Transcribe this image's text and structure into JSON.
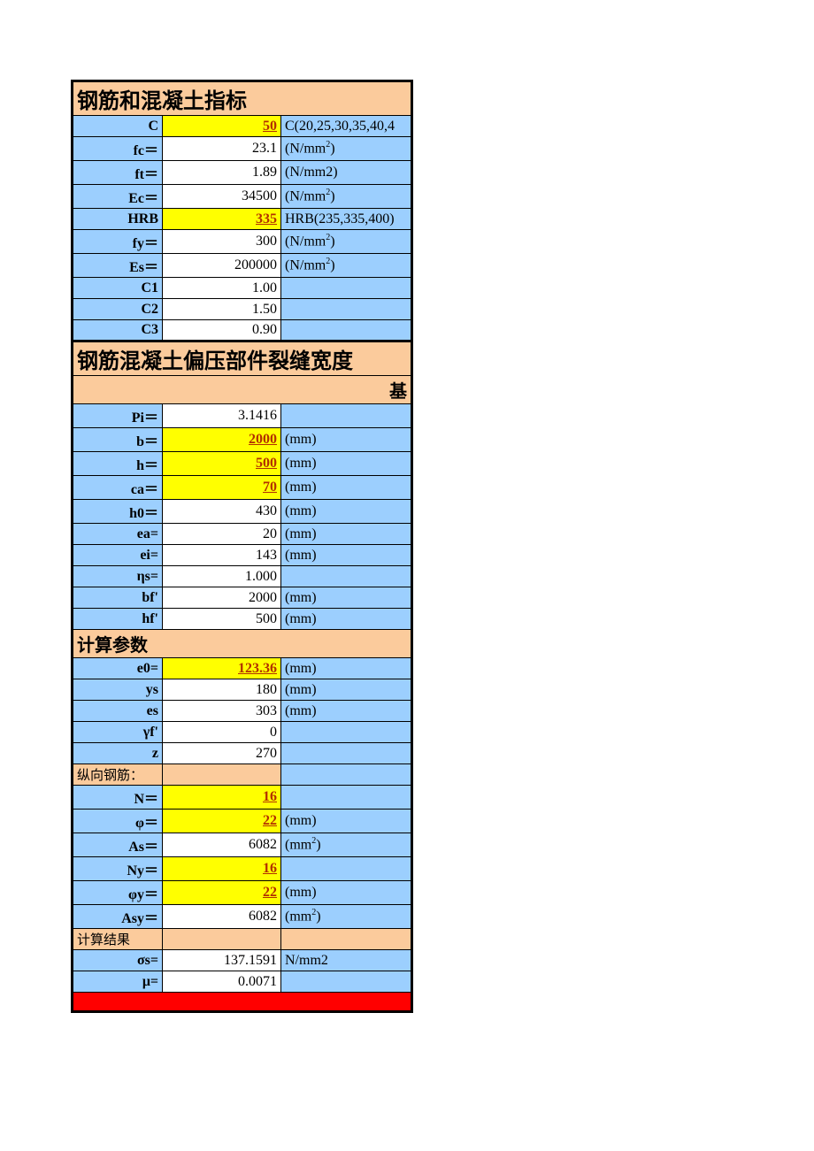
{
  "section1": {
    "title": "钢筋和混凝土指标",
    "rows": [
      {
        "label": "C",
        "value": "50",
        "unit": "C(20,25,30,35,40,4",
        "yellow": true,
        "bold": true
      },
      {
        "label": "fc＝",
        "value": "23.1",
        "unit": "(N/mm²)",
        "white": true
      },
      {
        "label": "ft＝",
        "value": "1.89",
        "unit": "(N/mm2)",
        "white": true
      },
      {
        "label": "Ec＝",
        "value": "34500",
        "unit": "(N/mm²)",
        "white": true
      },
      {
        "label": "HRB",
        "value": "335",
        "unit": "HRB(235,335,400)",
        "yellow": true,
        "bold": true
      },
      {
        "label": "fy＝",
        "value": "300",
        "unit": "(N/mm²)",
        "white": true
      },
      {
        "label": "Es＝",
        "value": "200000",
        "unit": "(N/mm²)",
        "white": true
      },
      {
        "label": "C1",
        "value": "1.00",
        "unit": "",
        "white": true
      },
      {
        "label": "C2",
        "value": "1.50",
        "unit": "",
        "white": true
      },
      {
        "label": "C3",
        "value": "0.90",
        "unit": "",
        "white": true
      }
    ]
  },
  "section2": {
    "title": "钢筋混凝土偏压部件裂缝宽度",
    "subtitle": "基",
    "rows": [
      {
        "label": "Pi＝",
        "value": "3.1416",
        "unit": "",
        "white": true
      },
      {
        "label": "b＝",
        "value": "2000",
        "unit": "(mm)",
        "yellow": true
      },
      {
        "label": "h＝",
        "value": "500",
        "unit": "(mm)",
        "yellow": true
      },
      {
        "label": "ca＝",
        "value": "70",
        "unit": "(mm)",
        "yellow": true
      },
      {
        "label": "h0＝",
        "value": "430",
        "unit": "(mm)",
        "white": true
      },
      {
        "label": "ea=",
        "value": "20",
        "unit": "(mm)",
        "white": true
      },
      {
        "label": "ei=",
        "value": "143",
        "unit": "(mm)",
        "white": true
      },
      {
        "label": "ηs=",
        "value": "1.000",
        "unit": "",
        "white": true
      },
      {
        "label": "bf'",
        "value": "2000",
        "unit": "(mm)",
        "white": true
      },
      {
        "label": "hf'",
        "value": "500",
        "unit": "(mm)",
        "white": true
      }
    ]
  },
  "section3": {
    "title": "计算参数",
    "rows": [
      {
        "label": "e0=",
        "value": "123.36",
        "unit": "(mm)",
        "yellow": true,
        "labelBlue": true
      },
      {
        "label": "ys",
        "value": "180",
        "unit": "(mm)",
        "white": true
      },
      {
        "label": "es",
        "value": "303",
        "unit": "(mm)",
        "white": true
      },
      {
        "label": "γf'",
        "value": "0",
        "unit": "",
        "white": true
      },
      {
        "label": "z",
        "value": "270",
        "unit": "",
        "white": true
      }
    ]
  },
  "section4": {
    "title": "纵向钢筋：",
    "rows": [
      {
        "label": "N＝",
        "value": "16",
        "unit": "",
        "yellow": true
      },
      {
        "label": "φ＝",
        "value": "22",
        "unit": "(mm)",
        "yellow": true
      },
      {
        "label": "As＝",
        "value": "6082",
        "unit": "(mm²)",
        "white": true
      },
      {
        "label": "Ny＝",
        "value": "16",
        "unit": "",
        "yellow": true
      },
      {
        "label": "φy＝",
        "value": "22",
        "unit": "(mm)",
        "yellow": true
      },
      {
        "label": "Asy＝",
        "value": "6082",
        "unit": "(mm²)",
        "white": true
      }
    ]
  },
  "section5": {
    "title": "计算结果",
    "rows": [
      {
        "label": "σs=",
        "value": "137.1591",
        "unit": "N/mm2",
        "white": true
      },
      {
        "label": "μ=",
        "value": "0.0071",
        "unit": "",
        "white": true
      }
    ]
  }
}
